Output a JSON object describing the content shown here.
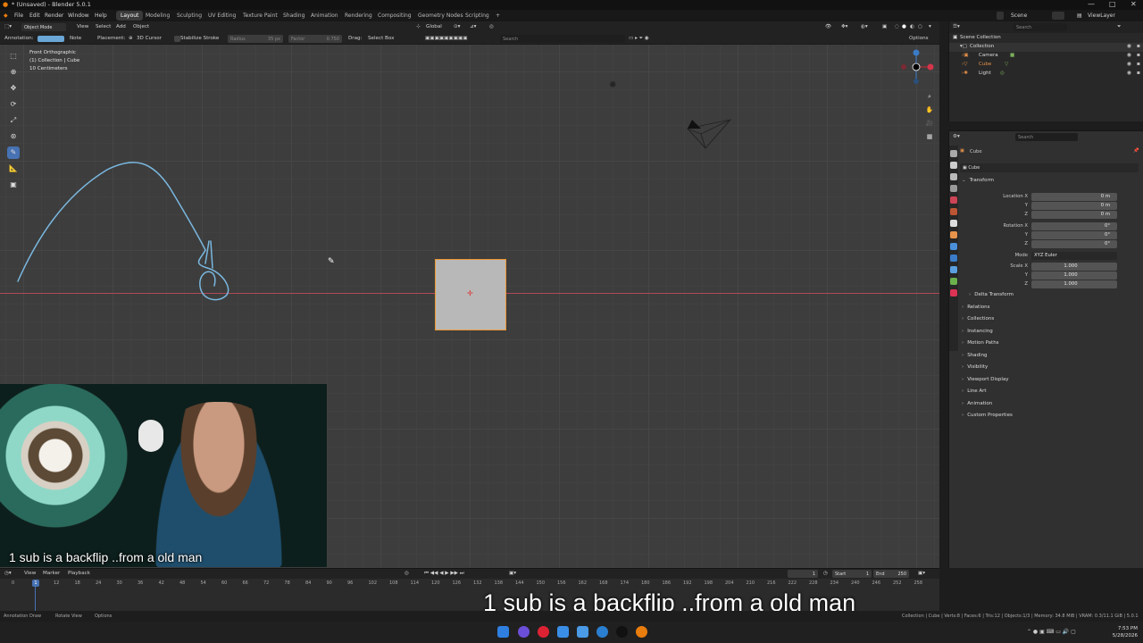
{
  "window": {
    "title": "* (Unsaved) - Blender 5.0.1",
    "controls": [
      "—",
      "□",
      "✕"
    ]
  },
  "menus": [
    "File",
    "Edit",
    "Render",
    "Window",
    "Help"
  ],
  "workspaces": [
    "Layout",
    "Modeling",
    "Sculpting",
    "UV Editing",
    "Texture Paint",
    "Shading",
    "Animation",
    "Rendering",
    "Compositing",
    "Geometry Nodes",
    "Scripting",
    "+"
  ],
  "active_workspace": "Layout",
  "scene": {
    "label": "Scene",
    "view_layer": "ViewLayer"
  },
  "viewport_header": {
    "mode": "Object Mode",
    "menus": [
      "View",
      "Select",
      "Add",
      "Object"
    ],
    "orientation": "Global"
  },
  "tool_header": {
    "annotation_label": "Annotation:",
    "note_label": "Note",
    "placement_label": "Placement:",
    "placement_value": "3D Cursor",
    "stabilize_label": "Stabilize Stroke",
    "radius_label": "Radius",
    "radius_value": "35 px",
    "factor_label": "Factor",
    "factor_value": "0.750",
    "drag_label": "Drag:",
    "drag_value": "Select Box",
    "search_placeholder": "Search",
    "options_label": "Options"
  },
  "viewport_info": {
    "view": "Front Orthographic",
    "collection": "(1) Collection | Cube",
    "scale": "10 Centimeters"
  },
  "outliner": {
    "title": "Scene Collection",
    "search_placeholder": "Search",
    "items": [
      {
        "name": "Collection",
        "indent": 0
      },
      {
        "name": "Camera",
        "indent": 1
      },
      {
        "name": "Cube",
        "indent": 1
      },
      {
        "name": "Light",
        "indent": 1
      }
    ]
  },
  "properties": {
    "search_placeholder": "Search",
    "object_name": "Cube",
    "object_field": "Cube",
    "transform_title": "Transform",
    "location": {
      "label": "Location X",
      "x": "0 m",
      "y": "0 m",
      "z": "0 m"
    },
    "rotation": {
      "label": "Rotation X",
      "x": "0°",
      "y": "0°",
      "z": "0°"
    },
    "mode": {
      "label": "Mode",
      "value": "XYZ Euler"
    },
    "scale": {
      "label": "Scale X",
      "x": "1.000",
      "y": "1.000",
      "z": "1.000"
    },
    "axis_y": "Y",
    "axis_z": "Z",
    "delta_transform": "Delta Transform",
    "panels": [
      "Relations",
      "Collections",
      "Instancing",
      "Motion Paths",
      "Shading",
      "Visibility",
      "Viewport Display",
      "Line Art",
      "Animation",
      "Custom Properties"
    ]
  },
  "timeline": {
    "menus": [
      "View",
      "Marker",
      "Playback"
    ],
    "current_frame": "1",
    "start_label": "Start",
    "start_value": "1",
    "end_label": "End",
    "end_value": "250",
    "ticks": [
      "0",
      "6",
      "12",
      "18",
      "24",
      "30",
      "36",
      "42",
      "48",
      "54",
      "60",
      "66",
      "72",
      "78",
      "84",
      "90",
      "96",
      "102",
      "108",
      "114",
      "120",
      "126",
      "132",
      "138",
      "144",
      "150",
      "156",
      "162",
      "168",
      "174",
      "180",
      "186",
      "192",
      "198",
      "204",
      "210",
      "216",
      "222",
      "228",
      "234",
      "240",
      "246",
      "252",
      "258"
    ],
    "playhead": "1"
  },
  "status_bar": {
    "left": [
      "Annotation Draw",
      "Rotate View",
      "Options"
    ],
    "right": "Collection | Cube | Verts:8 | Faces:6 | Tris:12 | Objects:1/3 | Memory: 34.8 MiB | VRAM: 0.3/11.1 GiB | 5.0.1"
  },
  "overlay": {
    "webcam_caption": "1 sub is a backflip ..from a old man",
    "big_caption": "1 sub is a backflip ..from a old man"
  },
  "taskbar": {
    "time": "7:53 PM",
    "date": "5/28/2026"
  },
  "colors": {
    "accent": "#4772b3",
    "annotation": "#7ab8e0",
    "selection": "#ee9933",
    "x_axis": "#b04a55"
  }
}
